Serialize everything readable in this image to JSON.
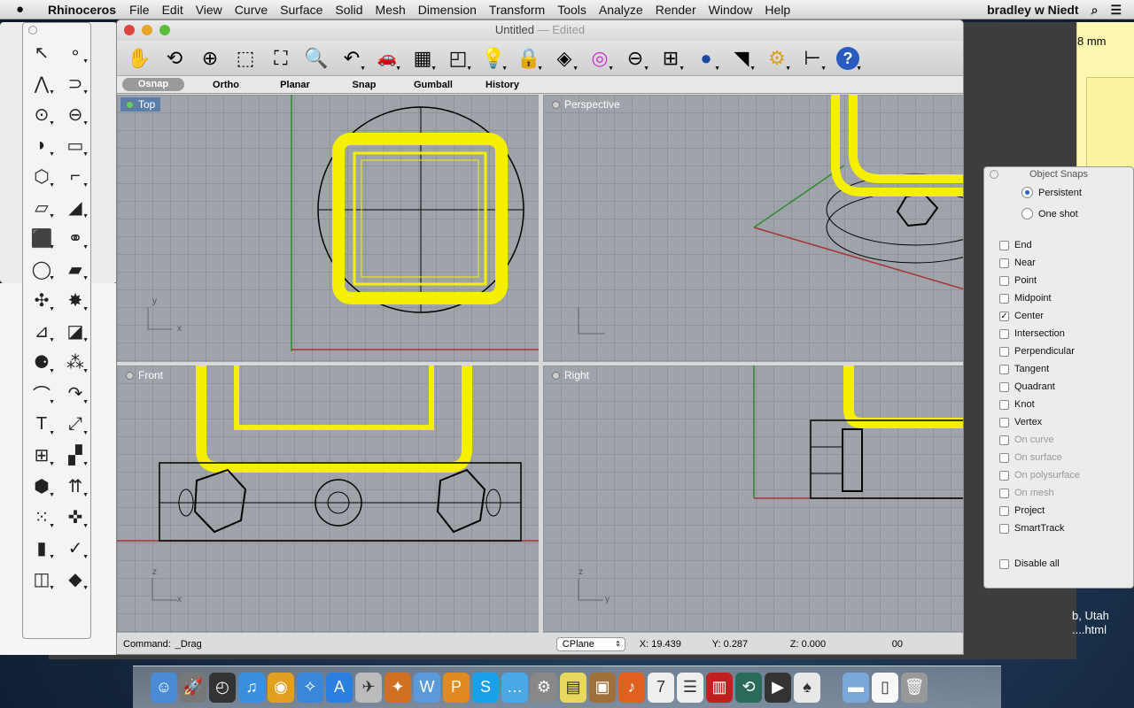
{
  "menubar": {
    "app": "Rhinoceros",
    "items": [
      "File",
      "Edit",
      "View",
      "Curve",
      "Surface",
      "Solid",
      "Mesh",
      "Dimension",
      "Transform",
      "Tools",
      "Analyze",
      "Render",
      "Window",
      "Help"
    ],
    "user": "bradley w Niedt"
  },
  "background": {
    "sticky_text": "8 mm",
    "right_text_1": "b, Utah",
    "right_text_2": "....html"
  },
  "window": {
    "title": "Untitled",
    "title_suffix": "— Edited"
  },
  "toolbar": [
    {
      "icon": "pan-hand-icon",
      "g": "✋"
    },
    {
      "icon": "rotate-view-icon",
      "g": "⟲"
    },
    {
      "icon": "zoom-in-out-icon",
      "g": "⊕"
    },
    {
      "icon": "zoom-window-icon",
      "g": "⬚"
    },
    {
      "icon": "zoom-extents-icon",
      "g": "⛶"
    },
    {
      "icon": "zoom-selected-icon",
      "g": "🔍"
    },
    {
      "icon": "undo-view-icon",
      "g": "↶"
    },
    {
      "icon": "car-named-views-icon",
      "g": "🚗"
    },
    {
      "icon": "cplane-icon",
      "g": "▦"
    },
    {
      "icon": "object-snaps-shapes-icon",
      "g": "◰"
    },
    {
      "icon": "lightbulb-icon",
      "g": "💡"
    },
    {
      "icon": "lock-icon",
      "g": "🔒"
    },
    {
      "icon": "layers-icon",
      "g": "◈"
    },
    {
      "icon": "color-wheel-icon",
      "g": "◎"
    },
    {
      "icon": "wireframe-sphere-icon",
      "g": "⊖"
    },
    {
      "icon": "grid-sphere-icon",
      "g": "⊞"
    },
    {
      "icon": "rendered-sphere-icon",
      "g": "●"
    },
    {
      "icon": "cone-light-icon",
      "g": "◥"
    },
    {
      "icon": "gear-options-icon",
      "g": "⚙"
    },
    {
      "icon": "dimension-icon",
      "g": "⊢"
    },
    {
      "icon": "help-icon",
      "g": "?"
    }
  ],
  "status_toggles": [
    {
      "label": "Osnap",
      "on": true
    },
    {
      "label": "Ortho",
      "on": false
    },
    {
      "label": "Planar",
      "on": false
    },
    {
      "label": "Snap",
      "on": false
    },
    {
      "label": "Gumball",
      "on": false
    },
    {
      "label": "History",
      "on": false
    }
  ],
  "viewports": {
    "top": "Top",
    "perspective": "Perspective",
    "front": "Front",
    "right": "Right"
  },
  "axes": {
    "x": "x",
    "y": "y",
    "z": "z"
  },
  "command": {
    "label": "Command:",
    "value": "_Drag",
    "cplane": "CPlane",
    "x": "X: 19.439",
    "y": "Y: 0.287",
    "z": "Z: 0.000",
    "extra": "00"
  },
  "palette": [
    [
      "select-arrow-icon",
      "↖"
    ],
    [
      "point-icon",
      "∘"
    ],
    [
      "polyline-icon",
      "⋀"
    ],
    [
      "curve-icon",
      "⊃"
    ],
    [
      "circle-icon",
      "⊙"
    ],
    [
      "ellipse-icon",
      "⊖"
    ],
    [
      "arc-icon",
      "◗"
    ],
    [
      "rectangle-icon",
      "▭"
    ],
    [
      "polygon-icon",
      "⬡"
    ],
    [
      "fillet-icon",
      "⌐"
    ],
    [
      "surface-icon",
      "▱"
    ],
    [
      "loft-icon",
      "◢"
    ],
    [
      "box-icon",
      "⬛"
    ],
    [
      "boolean-spheres-icon",
      "⚭"
    ],
    [
      "cylinder-icon",
      "◯"
    ],
    [
      "surface-patch-icon",
      "▰"
    ],
    [
      "puzzle-icon",
      "✣"
    ],
    [
      "explode-icon",
      "✸"
    ],
    [
      "trim-icon",
      "⊿"
    ],
    [
      "split-icon",
      "◪"
    ],
    [
      "group-icon",
      "⚈"
    ],
    [
      "ungroup-icon",
      "⁂"
    ],
    [
      "offset-curve-icon",
      "⌒"
    ],
    [
      "curve-tools-icon",
      "↷"
    ],
    [
      "text-icon",
      "T"
    ],
    [
      "transform-scale-icon",
      "⤢"
    ],
    [
      "array-icon",
      "⊞"
    ],
    [
      "extrude-icon",
      "▞"
    ],
    [
      "solid-tools-icon",
      "⬢"
    ],
    [
      "mesh-icon",
      "⇈"
    ],
    [
      "grid-array-icon",
      "⁙"
    ],
    [
      "move-icon",
      "✜"
    ],
    [
      "analyze-icon",
      "▮"
    ],
    [
      "check-icon",
      "✓"
    ],
    [
      "render-icon",
      "◫"
    ],
    [
      "paint-icon",
      "◆"
    ]
  ],
  "object_snaps": {
    "title": "Object Snaps",
    "modes": [
      {
        "label": "Persistent",
        "selected": true
      },
      {
        "label": "One shot",
        "selected": false
      }
    ],
    "items": [
      {
        "label": "End",
        "checked": false,
        "enabled": true
      },
      {
        "label": "Near",
        "checked": false,
        "enabled": true
      },
      {
        "label": "Point",
        "checked": false,
        "enabled": true
      },
      {
        "label": "Midpoint",
        "checked": false,
        "enabled": true
      },
      {
        "label": "Center",
        "checked": true,
        "enabled": true
      },
      {
        "label": "Intersection",
        "checked": false,
        "enabled": true
      },
      {
        "label": "Perpendicular",
        "checked": false,
        "enabled": true
      },
      {
        "label": "Tangent",
        "checked": false,
        "enabled": true
      },
      {
        "label": "Quadrant",
        "checked": false,
        "enabled": true
      },
      {
        "label": "Knot",
        "checked": false,
        "enabled": true
      },
      {
        "label": "Vertex",
        "checked": false,
        "enabled": true
      },
      {
        "label": "On curve",
        "checked": false,
        "enabled": false
      },
      {
        "label": "On surface",
        "checked": false,
        "enabled": false
      },
      {
        "label": "On polysurface",
        "checked": false,
        "enabled": false
      },
      {
        "label": "On mesh",
        "checked": false,
        "enabled": false
      },
      {
        "label": "Project",
        "checked": false,
        "enabled": true
      },
      {
        "label": "SmartTrack",
        "checked": false,
        "enabled": true
      }
    ],
    "disable_all": "Disable all"
  },
  "dock": [
    [
      "finder-icon",
      "#4a8bd6",
      "☺"
    ],
    [
      "launchpad-icon",
      "#777",
      "🚀"
    ],
    [
      "dashboard-icon",
      "#333",
      "◴"
    ],
    [
      "itunes-icon",
      "#3a8ee0",
      "♫"
    ],
    [
      "chrome-icon",
      "#e0a020",
      "◉"
    ],
    [
      "safari-icon",
      "#3a86d8",
      "✧"
    ],
    [
      "app-store-icon",
      "#2a7fe0",
      "A"
    ],
    [
      "preview-icon",
      "#bbb",
      "✈"
    ],
    [
      "blender-icon",
      "#d07020",
      "✦"
    ],
    [
      "word-icon",
      "#5a9ad8",
      "W"
    ],
    [
      "pages-icon",
      "#e08a20",
      "P"
    ],
    [
      "skype-icon",
      "#1aa0e8",
      "S"
    ],
    [
      "messages-icon",
      "#4aa8e8",
      "…"
    ],
    [
      "system-prefs-icon",
      "#888",
      "⚙"
    ],
    [
      "stickies-icon",
      "#e8d860",
      "▤"
    ],
    [
      "iphoto-icon",
      "#a0703a",
      "▣"
    ],
    [
      "audacity-icon",
      "#e06020",
      "♪"
    ],
    [
      "calendar-icon",
      "#eee",
      "7"
    ],
    [
      "reminders-icon",
      "#eee",
      "☰"
    ],
    [
      "photo-booth-icon",
      "#c02020",
      "▥"
    ],
    [
      "time-machine-icon",
      "#2a6a5a",
      "⟲"
    ],
    [
      "dvd-player-icon",
      "#333",
      "▶"
    ],
    [
      "solitaire-icon",
      "#e8e8e8",
      "♠"
    ],
    [
      "documents-folder-icon",
      "#7aa8d8",
      "▬"
    ],
    [
      "file-icon",
      "#f8f8f8",
      "▯"
    ],
    [
      "trash-icon",
      "#999",
      "🗑"
    ]
  ]
}
